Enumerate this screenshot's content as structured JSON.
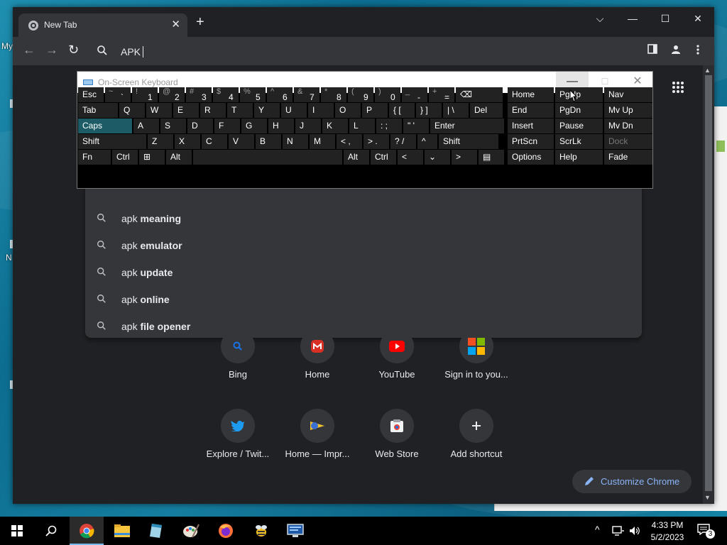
{
  "desktop": {
    "frag_my": "My",
    "frag_n": "N"
  },
  "browser": {
    "tab_title": "New Tab",
    "tab_close": "✕",
    "new_tab": "+",
    "win_caret": "⌵",
    "win_min": "—",
    "win_max": "☐",
    "win_close": "✕",
    "omnibox_value": "APK"
  },
  "suggestions": [
    {
      "prefix": "apk ",
      "bold": "meaning"
    },
    {
      "prefix": "apk ",
      "bold": "emulator"
    },
    {
      "prefix": "apk ",
      "bold": "update"
    },
    {
      "prefix": "apk ",
      "bold": "online"
    },
    {
      "prefix": "apk ",
      "bold": "file opener"
    }
  ],
  "shortcuts": [
    {
      "label": "Bing",
      "icon": "bing-search-icon"
    },
    {
      "label": "Home",
      "icon": "gmail-icon"
    },
    {
      "label": "YouTube",
      "icon": "youtube-icon"
    },
    {
      "label": "Sign in to you...",
      "icon": "microsoft-icon"
    },
    {
      "label": "Explore / Twit...",
      "icon": "twitter-icon"
    },
    {
      "label": "Home — Impr...",
      "icon": "impress-icon"
    },
    {
      "label": "Web Store",
      "icon": "web-store-icon"
    },
    {
      "label": "Add shortcut",
      "icon": "plus-icon"
    }
  ],
  "customize_label": "Customize Chrome",
  "osk": {
    "title": "On-Screen Keyboard",
    "min": "—",
    "max": "☐",
    "close": "✕",
    "row1": [
      {
        "sym": "",
        "main": "Esc"
      },
      {
        "sym": "~",
        "main": "`"
      },
      {
        "sym": "!",
        "main": "1"
      },
      {
        "sym": "@",
        "main": "2"
      },
      {
        "sym": "#",
        "main": "3"
      },
      {
        "sym": "$",
        "main": "4"
      },
      {
        "sym": "%",
        "main": "5"
      },
      {
        "sym": "^",
        "main": "6"
      },
      {
        "sym": "&",
        "main": "7"
      },
      {
        "sym": "*",
        "main": "8"
      },
      {
        "sym": "(",
        "main": "9"
      },
      {
        "sym": ")",
        "main": "0"
      },
      {
        "sym": "_",
        "main": "-"
      },
      {
        "sym": "+",
        "main": "="
      },
      {
        "sym": "",
        "main": "⌫"
      }
    ],
    "row2": [
      "Tab",
      "Q",
      "W",
      "E",
      "R",
      "T",
      "Y",
      "U",
      "I",
      "O",
      "P",
      "{ [",
      "} ]",
      "| \\",
      "Del"
    ],
    "row3": [
      "Caps",
      "A",
      "S",
      "D",
      "F",
      "G",
      "H",
      "J",
      "K",
      "L",
      ": ;",
      "\" '",
      "Enter"
    ],
    "row4": [
      "Shift",
      "Z",
      "X",
      "C",
      "V",
      "B",
      "N",
      "M",
      "< ,",
      "> .",
      "? /",
      "^",
      "Shift"
    ],
    "row5": [
      "Fn",
      "Ctrl",
      "⊞",
      "Alt",
      "",
      "Alt",
      "Ctrl",
      "<",
      "⌄",
      ">",
      "▤"
    ],
    "nav": [
      [
        "Home",
        "PgUp",
        "Nav"
      ],
      [
        "End",
        "PgDn",
        "Mv Up"
      ],
      [
        "Insert",
        "Pause",
        "Mv Dn"
      ],
      [
        "PrtScn",
        "ScrLk",
        "Dock"
      ],
      [
        "Options",
        "Help",
        "Fade"
      ]
    ]
  },
  "taskbar": {
    "time": "4:33 PM",
    "date": "5/2/2023",
    "notification_count": "3",
    "apps": [
      "start-icon",
      "search-icon",
      "chrome-icon",
      "file-explorer-icon",
      "notepad-icon",
      "paint-icon",
      "firefox-icon",
      "bee-app-icon",
      "monitor-app-icon"
    ]
  }
}
